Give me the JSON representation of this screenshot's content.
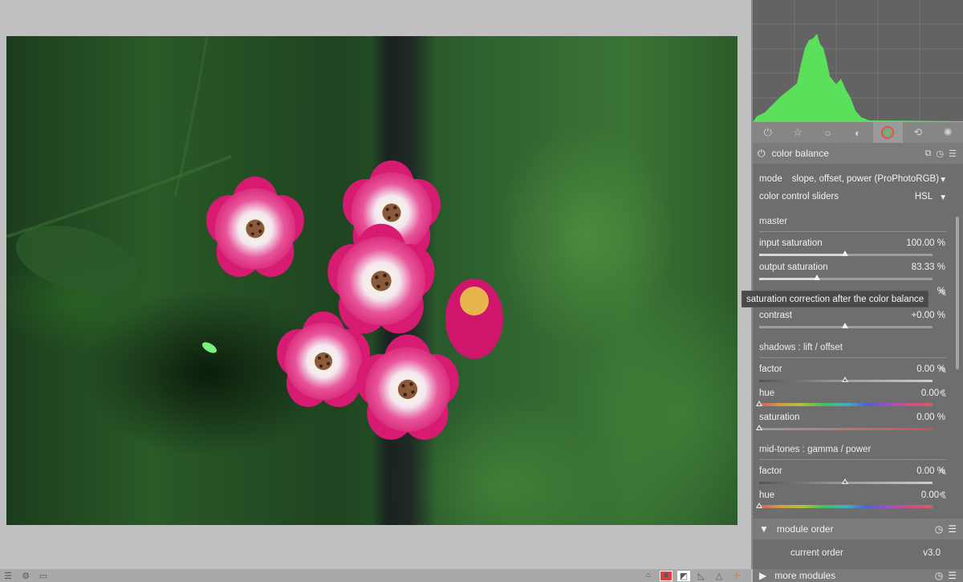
{
  "image": {
    "description_free": true
  },
  "tabs": {
    "icons": [
      "power-icon",
      "star-icon",
      "circle-icon",
      "tone-icon",
      "color-icon",
      "correct-icon",
      "effect-icon"
    ],
    "active_index": 4
  },
  "module": {
    "title": "color balance",
    "mode_label": "mode",
    "mode_value": "slope, offset, power (ProPhotoRGB)",
    "sliders_label": "color control sliders",
    "sliders_value": "HSL",
    "master_section": "master",
    "input_saturation_label": "input saturation",
    "input_saturation_value": "100.00 %",
    "input_saturation_fraction": 0.5,
    "output_saturation_label": "output saturation",
    "output_saturation_value": "83.33 %",
    "output_saturation_fraction": 0.33,
    "hidden_value_suffix": "%",
    "contrast_label": "contrast",
    "contrast_value": "+0.00 %",
    "contrast_fraction": 0.5,
    "shadows_section": "shadows : lift / offset",
    "shadows_factor_label": "factor",
    "shadows_factor_value": "0.00 %",
    "shadows_hue_label": "hue",
    "shadows_hue_value": "0.00 °",
    "shadows_saturation_label": "saturation",
    "shadows_saturation_value": "0.00 %",
    "midtones_section": "mid-tones : gamma / power",
    "midtones_factor_label": "factor",
    "midtones_factor_value": "0.00 %",
    "midtones_hue_label": "hue",
    "midtones_hue_value": "0.00 °"
  },
  "tooltip": "saturation correction after the color balance",
  "module_order": {
    "title": "module order",
    "current_label": "current order",
    "current_value": "v3.0"
  },
  "more_modules": {
    "title": "more modules"
  },
  "colors": {
    "histogram_fill": "#5be05b",
    "panel_bg": "#6e6e6e",
    "tooltip_bg": "#4a4a4a"
  }
}
